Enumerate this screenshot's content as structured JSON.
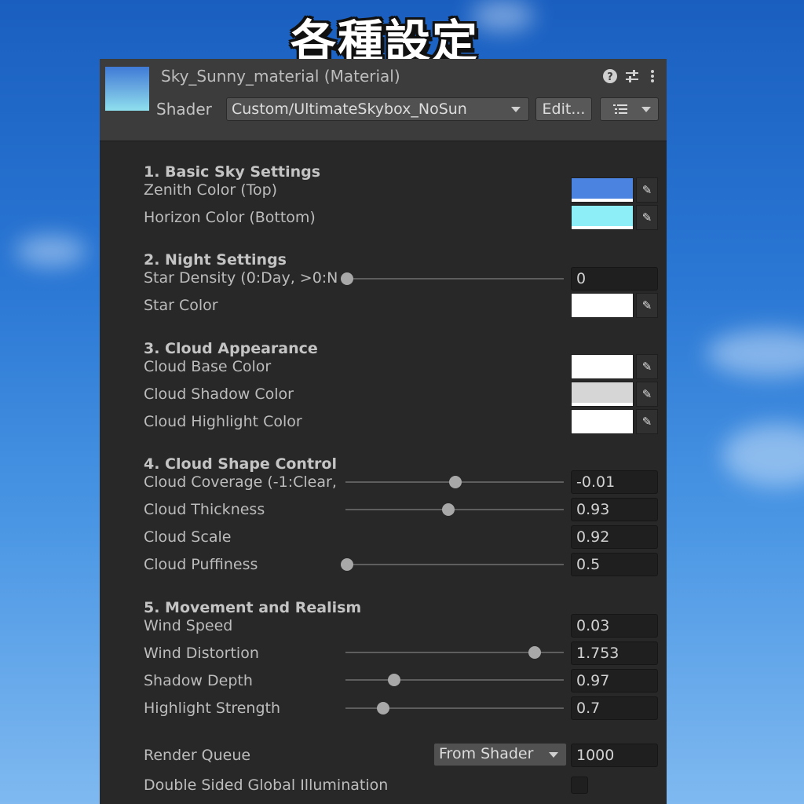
{
  "banner": "各種設定",
  "header": {
    "title": "Sky_Sunny_material (Material)",
    "shader_label": "Shader",
    "shader_value": "Custom/UltimateSkybox_NoSun",
    "edit_label": "Edit...",
    "icons": [
      "help-icon",
      "settings-sliders-icon",
      "more-vert-icon",
      "list-icon",
      "chevron-down-icon"
    ]
  },
  "sections": {
    "s1": "1. Basic Sky Settings",
    "s2": "2. Night Settings",
    "s3": "3. Cloud Appearance",
    "s4": "4. Cloud Shape Control",
    "s5": "5. Movement and Realism"
  },
  "colors": {
    "zenith": "#4a84e0",
    "horizon": "#8eeef8",
    "star": "#ffffff",
    "cloud_base": "#ffffff",
    "cloud_shadow": "#d6d6d6",
    "cloud_highlight": "#ffffff"
  },
  "props": {
    "zenith_color": {
      "label": "Zenith Color (Top)"
    },
    "horizon_color": {
      "label": "Horizon Color (Bottom)"
    },
    "star_density": {
      "label": "Star Density (0:Day, >0:N",
      "value": "0",
      "slider_fraction": 0.0
    },
    "star_color": {
      "label": "Star Color"
    },
    "cloud_base_color": {
      "label": "Cloud Base Color"
    },
    "cloud_shadow_color": {
      "label": "Cloud Shadow Color"
    },
    "cloud_highlight_color": {
      "label": "Cloud Highlight Color"
    },
    "cloud_coverage": {
      "label": "Cloud Coverage (-1:Clear,",
      "value": "-0.01",
      "slider_fraction": 0.495
    },
    "cloud_thickness": {
      "label": "Cloud Thickness",
      "value": "0.93",
      "slider_fraction": 0.465
    },
    "cloud_scale": {
      "label": "Cloud Scale",
      "value": "0.92"
    },
    "cloud_puffiness": {
      "label": "Cloud Puffiness",
      "value": "0.5",
      "slider_fraction": 0.0
    },
    "wind_speed": {
      "label": "Wind Speed",
      "value": "0.03"
    },
    "wind_distortion": {
      "label": "Wind Distortion",
      "value": "1.753",
      "slider_fraction": 0.86
    },
    "shadow_depth": {
      "label": "Shadow Depth",
      "value": "0.97",
      "slider_fraction": 0.215
    },
    "highlight_strength": {
      "label": "Highlight Strength",
      "value": "0.7",
      "slider_fraction": 0.165
    },
    "render_queue": {
      "label": "Render Queue",
      "mode": "From Shader",
      "value": "1000"
    },
    "double_sided_gi": {
      "label": "Double Sided Global Illumination",
      "checked": false
    }
  }
}
